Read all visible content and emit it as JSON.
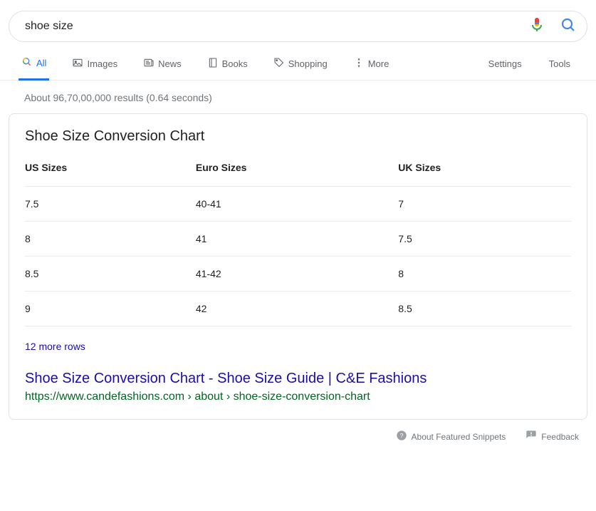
{
  "search": {
    "query": "shoe size"
  },
  "tabs": {
    "all": "All",
    "images": "Images",
    "news": "News",
    "books": "Books",
    "shopping": "Shopping",
    "more": "More",
    "settings": "Settings",
    "tools": "Tools"
  },
  "stats": "About 96,70,00,000 results (0.64 seconds)",
  "snippet": {
    "title": "Shoe Size Conversion Chart",
    "columns": {
      "c0": "US Sizes",
      "c1": "Euro Sizes",
      "c2": "UK Sizes"
    },
    "rows": {
      "r0": {
        "c0": "7.5",
        "c1": "40-41",
        "c2": "7"
      },
      "r1": {
        "c0": "8",
        "c1": "41",
        "c2": "7.5"
      },
      "r2": {
        "c0": "8.5",
        "c1": "41-42",
        "c2": "8"
      },
      "r3": {
        "c0": "9",
        "c1": "42",
        "c2": "8.5"
      }
    },
    "more_rows": "12 more rows",
    "link_title": "Shoe Size Conversion Chart - Shoe Size Guide | C&E Fashions",
    "link_url": "https://www.candefashions.com › about › shoe-size-conversion-chart"
  },
  "footer": {
    "about": "About Featured Snippets",
    "feedback": "Feedback"
  },
  "chart_data": {
    "type": "table",
    "title": "Shoe Size Conversion Chart",
    "columns": [
      "US Sizes",
      "Euro Sizes",
      "UK Sizes"
    ],
    "rows": [
      [
        "7.5",
        "40-41",
        "7"
      ],
      [
        "8",
        "41",
        "7.5"
      ],
      [
        "8.5",
        "41-42",
        "8"
      ],
      [
        "9",
        "42",
        "8.5"
      ]
    ],
    "note": "12 more rows"
  }
}
